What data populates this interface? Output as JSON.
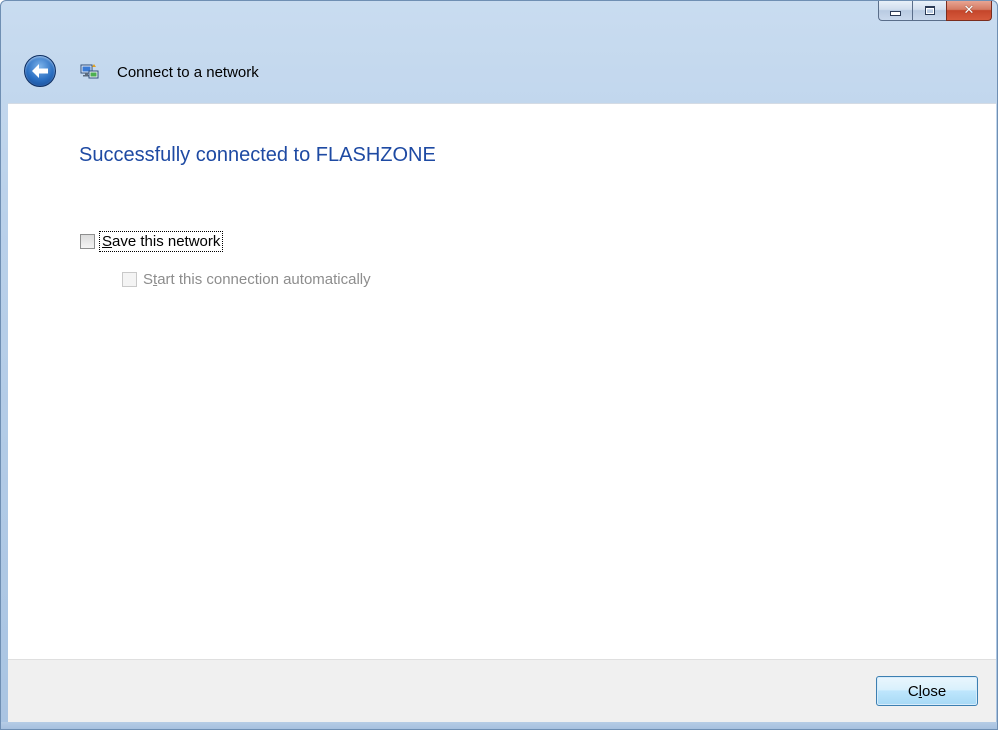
{
  "window": {
    "title": "Connect to a network",
    "caption_buttons": {
      "minimize_icon": "minimize-icon",
      "maximize_icon": "maximize-icon",
      "close_icon": "close-icon"
    }
  },
  "header": {
    "back_icon": "back-arrow-icon",
    "network_icon": "network-icon",
    "title": "Connect to a network"
  },
  "content": {
    "heading": "Successfully connected to FLASHZONE",
    "save_network": {
      "label_first": "S",
      "label_rest": "ave this network",
      "checked": false
    },
    "auto_connect": {
      "label_first": "S",
      "label_underlined": "t",
      "label_rest": "art this connection automatically",
      "checked": false,
      "enabled": false
    }
  },
  "footer": {
    "close_label_first": "C",
    "close_label_underlined": "l",
    "close_label_rest": "ose"
  },
  "colors": {
    "heading": "#1e4aa3",
    "chrome": "#bad1ea",
    "disabled_text": "#8d8d8d",
    "close_caption": "#c4452a"
  }
}
